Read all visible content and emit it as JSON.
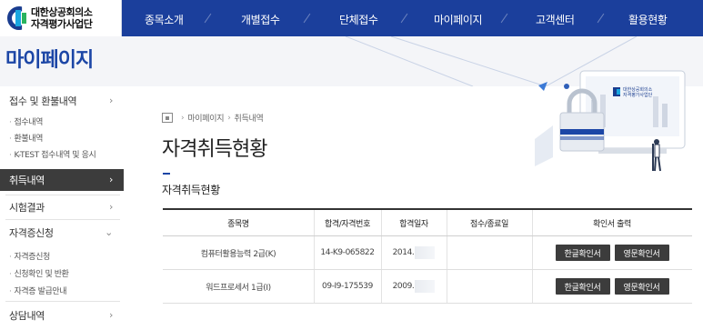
{
  "logo": {
    "line1": "대한상공회의소",
    "line2": "자격평가사업단"
  },
  "nav": [
    "종목소개",
    "개별접수",
    "단체접수",
    "마이페이지",
    "고객센터",
    "활용현황"
  ],
  "page": {
    "heading": "마이페이지",
    "title": "자격취득현황",
    "section_title": "자격취득현황"
  },
  "breadcrumb": [
    "마이페이지",
    "취득내역"
  ],
  "sidebar": [
    {
      "label": "접수 및 환불내역",
      "chevron": "›",
      "subs": [
        "접수내역",
        "환불내역",
        "K-TEST 접수내역 및 응시"
      ]
    },
    {
      "label": "취득내역",
      "chevron": "›",
      "active": true
    },
    {
      "label": "시험결과",
      "chevron": "›"
    },
    {
      "label": "자격증신청",
      "chevron": "⌄",
      "subs": [
        "자격증신청",
        "신청확인 및 반환",
        "자격증 발급안내"
      ]
    },
    {
      "label": "상담내역",
      "chevron": "›"
    }
  ],
  "table": {
    "headers": [
      "종목명",
      "합격/자격번호",
      "합격일자",
      "점수/종료일",
      "확인서 출력"
    ],
    "rows": [
      {
        "name": "컴퓨터활용능력 2급(K)",
        "number": "14-K9-065822",
        "date": "2014.",
        "score": "",
        "btn_kr": "한글확인서",
        "btn_en": "영문확인서"
      },
      {
        "name": "워드프로세서 1급(I)",
        "number": "09-I9-175539",
        "date": "2009.",
        "score": "",
        "btn_kr": "한글확인서",
        "btn_en": "영문확인서"
      }
    ]
  },
  "illustration": {
    "logo_line1": "대한상공회의소",
    "logo_line2": "자격평가사업단"
  },
  "colors": {
    "nav_bg": "#1b3f9c",
    "accent": "#1c46a6",
    "button_bg": "#3c3c3c",
    "active_menu_bg": "#3c3c3c"
  }
}
